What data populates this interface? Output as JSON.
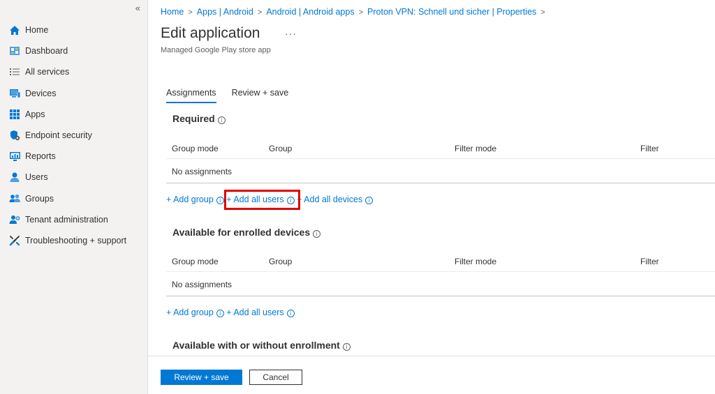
{
  "sidebar": {
    "collapse_glyph": "«",
    "items": [
      {
        "label": "Home",
        "icon": "home-icon"
      },
      {
        "label": "Dashboard",
        "icon": "dashboard-icon"
      },
      {
        "label": "All services",
        "icon": "list-icon"
      },
      {
        "label": "Devices",
        "icon": "devices-icon"
      },
      {
        "label": "Apps",
        "icon": "apps-icon"
      },
      {
        "label": "Endpoint security",
        "icon": "shield-icon"
      },
      {
        "label": "Reports",
        "icon": "reports-icon"
      },
      {
        "label": "Users",
        "icon": "user-icon"
      },
      {
        "label": "Groups",
        "icon": "groups-icon"
      },
      {
        "label": "Tenant administration",
        "icon": "tenant-admin-icon"
      },
      {
        "label": "Troubleshooting + support",
        "icon": "wrench-icon"
      }
    ]
  },
  "breadcrumb": [
    "Home",
    "Apps | Android",
    "Android | Android apps",
    "Proton VPN: Schnell und sicher | Properties"
  ],
  "header": {
    "title": "Edit application",
    "more": "···",
    "subtitle": "Managed Google Play store app"
  },
  "tabs": [
    {
      "label": "Assignments",
      "active": true
    },
    {
      "label": "Review + save",
      "active": false
    }
  ],
  "columns": [
    "Group mode",
    "Group",
    "Filter mode",
    "Filter"
  ],
  "sections": [
    {
      "title": "Required",
      "empty_text": "No assignments",
      "links": [
        "+ Add group",
        "+ Add all users",
        "+ Add all devices"
      ]
    },
    {
      "title": "Available for enrolled devices",
      "empty_text": "No assignments",
      "links": [
        "+ Add group",
        "+ Add all users"
      ]
    },
    {
      "title": "Available with or without enrollment"
    }
  ],
  "footer": {
    "primary": "Review + save",
    "secondary": "Cancel"
  },
  "colors": {
    "accent": "#0078d4",
    "highlight": "#e00000"
  }
}
